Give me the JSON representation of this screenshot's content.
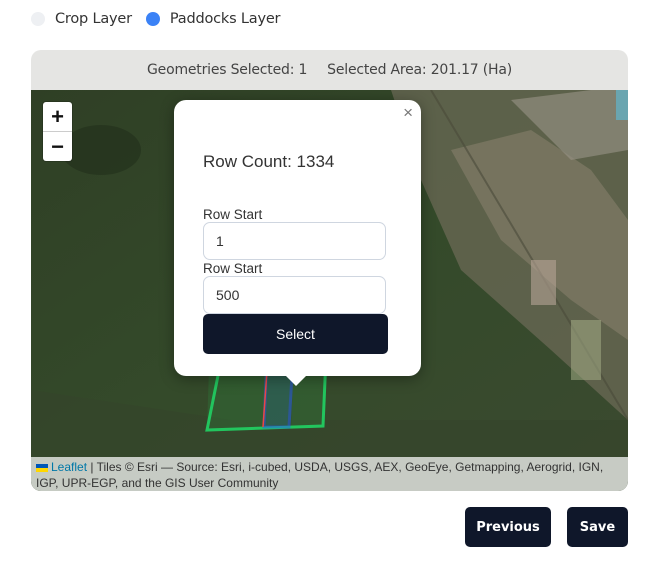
{
  "layers": [
    {
      "label": "Crop Layer",
      "selected": false
    },
    {
      "label": "Paddocks Layer",
      "selected": true
    }
  ],
  "header": {
    "geometries": "Geometries Selected: 1",
    "area": "Selected Area: 201.17 (Ha)"
  },
  "zoom": {
    "in": "+",
    "out": "−"
  },
  "popup": {
    "close": "×",
    "row_count": "Row Count: 1334",
    "field1_label": "Row Start",
    "field1_value": "1",
    "field2_label": "Row Start",
    "field2_value": "500",
    "button": "Select"
  },
  "attribution": {
    "leaflet": "Leaflet",
    "text": " | Tiles © Esri — Source: Esri, i-cubed, USDA, USGS, AEX, GeoEye, Getmapping, Aerogrid, IGN, IGP, UPR-EGP, and the GIS User Community"
  },
  "colors": {
    "radio_active": "#3b82f6",
    "button_bg": "#0f172a",
    "paddock_outline": "#22c55e",
    "selected_outline": "#2563eb",
    "row_outline": "#ef4444"
  },
  "footer": {
    "previous": "Previous",
    "save": "Save"
  }
}
